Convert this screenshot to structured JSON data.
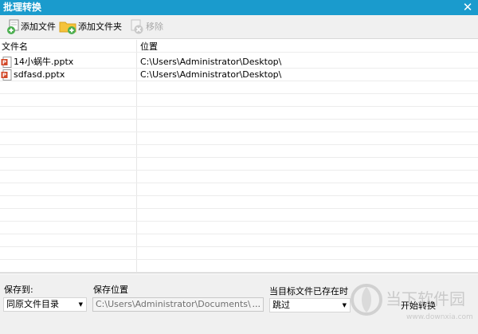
{
  "window": {
    "title": "批理转换",
    "close_glyph": "✕"
  },
  "toolbar": {
    "add_file": {
      "label": "添加文件",
      "icon": "add-file-icon"
    },
    "add_folder": {
      "label": "添加文件夹",
      "icon": "add-folder-icon"
    },
    "remove": {
      "label": "移除",
      "icon": "remove-icon",
      "disabled": true
    }
  },
  "file_list": {
    "columns": [
      "文件名",
      "位置"
    ],
    "rows": [
      {
        "name": "14小蜗牛.pptx",
        "location": "C:\\Users\\Administrator\\Desktop\\",
        "icon": "pptx-file-icon"
      },
      {
        "name": "sdfasd.pptx",
        "location": "C:\\Users\\Administrator\\Desktop\\",
        "icon": "pptx-file-icon"
      }
    ]
  },
  "options": {
    "save_to": {
      "label": "保存到:",
      "value": "同原文件目录"
    },
    "save_location": {
      "label": "保存位置",
      "value": "C:\\Users\\Administrator\\Documents\\",
      "browse": "..."
    },
    "if_exists": {
      "label": "当目标文件已存在时",
      "value": "跳过"
    },
    "start_label": "开始转换"
  },
  "watermark": {
    "text": "当下软件园",
    "url": "www.downxia.com"
  },
  "colors": {
    "titlebar": "#1a9bcd",
    "pptx_icon": "#d24726",
    "add_badge": "#4caf50",
    "folder": "#f5c33b"
  }
}
